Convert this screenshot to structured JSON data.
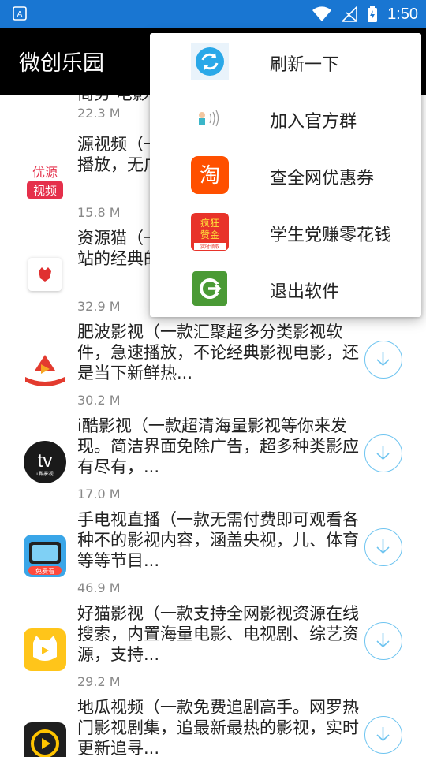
{
  "status_bar": {
    "time": "1:50"
  },
  "app": {
    "title": "微创乐园"
  },
  "list": {
    "items": [
      {
        "desc": "商务·电影",
        "size": "22.3 M"
      },
      {
        "desc": "源视频（一款超多分类影视资源，超清播放，无广告，",
        "size": "15.8 M"
      },
      {
        "desc": "资源猫（一款聚合资源，几十个视频网站的经典的视频，",
        "size": "32.9 M"
      },
      {
        "desc": "肥波影视（一款汇聚超多分类影视软件，急速播放，不论经典影视电影，还是当下新鲜热...",
        "size": "30.2 M"
      },
      {
        "desc": "i酷影视（一款超清海量影视等你来发现。简洁界面免除广告，超多种类影应有尽有，...",
        "size": "17.0 M"
      },
      {
        "desc": "手电视直播（一款无需付费即可观看各种不的影视内容，涵盖央视，儿、体育等等节目...",
        "size": "46.9 M"
      },
      {
        "desc": "好猫影视（一款支持全网影视资源在线搜索，内置海量电影、电视剧、综艺资源，支持...",
        "size": "29.2 M"
      },
      {
        "desc": "地瓜视频（一款免费追剧高手。网罗热门影视剧集，追最新最热的影视，实时更新追寻...",
        "size": ""
      }
    ]
  },
  "menu": {
    "items": [
      {
        "label": "刷新一下",
        "icon": "refresh-icon"
      },
      {
        "label": "加入官方群",
        "icon": "qq-group-icon"
      },
      {
        "label": "查全网优惠券",
        "icon": "taobao-icon"
      },
      {
        "label": "学生党赚零花钱",
        "icon": "crazy-money-icon"
      },
      {
        "label": "退出软件",
        "icon": "exit-icon"
      }
    ]
  },
  "app_icons": {
    "item1": {
      "line1": "优源",
      "line2": "视频"
    },
    "item4": {
      "text": "tv",
      "sub": "i 酷影视"
    },
    "item5": {
      "badge": "免费看"
    },
    "taobao": {
      "text": "淘"
    },
    "crazy_money": {
      "line1": "疯狂",
      "line2": "赞金",
      "line3": "实时领取"
    }
  },
  "colors": {
    "status_bar": "#1976d2",
    "app_bar": "#000000",
    "download_ring": "#6ec4f0"
  }
}
